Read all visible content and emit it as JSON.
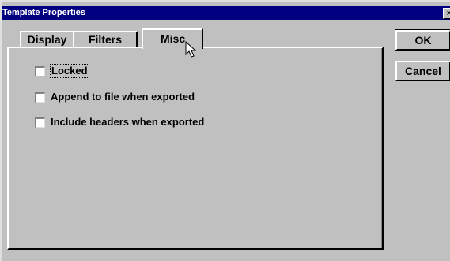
{
  "window": {
    "title": "Template Properties",
    "close_label": "×"
  },
  "tabs": [
    {
      "label": "Display",
      "active": false
    },
    {
      "label": "Filters",
      "active": false
    },
    {
      "label": "Misc",
      "active": true
    }
  ],
  "options": [
    {
      "label": "Locked",
      "checked": false,
      "focused": true
    },
    {
      "label": "Append to file when exported",
      "checked": false,
      "focused": false
    },
    {
      "label": "Include headers when exported",
      "checked": false,
      "focused": false
    }
  ],
  "buttons": {
    "ok_label": "OK",
    "cancel_label": "Cancel"
  },
  "colors": {
    "titlebar": "#000080",
    "face": "#c0c0c0"
  },
  "icons": {
    "cursor": "arrow-cursor-icon"
  }
}
